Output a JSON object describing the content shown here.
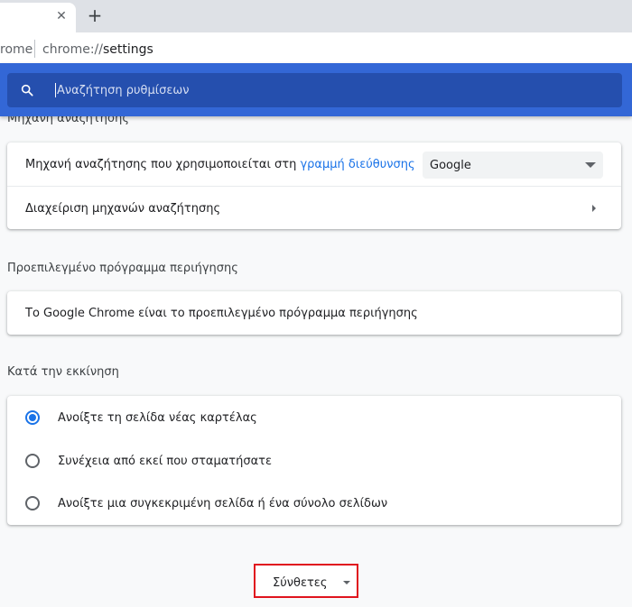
{
  "browser": {
    "tab_close_icon": "close-icon",
    "new_tab_icon": "plus-icon",
    "close_glyph": "✕",
    "plus_glyph": "+",
    "omnibox_prefix": "rome",
    "url_scheme": "chrome://",
    "url_host": "settings"
  },
  "search": {
    "placeholder": "Αναζήτηση ρυθμίσεων",
    "icon": "search-icon"
  },
  "sections": {
    "search_engine": {
      "title": "Μηχανή αναζήτησης",
      "row1_text": "Μηχανή αναζήτησης που χρησιμοποιείται στη ",
      "row1_link": "γραμμή διεύθυνσης",
      "select_value": "Google",
      "row2_text": "Διαχείριση μηχανών αναζήτησης"
    },
    "default_browser": {
      "title": "Προεπιλεγμένο πρόγραμμα περιήγησης",
      "row_text": "Το Google Chrome είναι το προεπιλεγμένο πρόγραμμα περιήγησης"
    },
    "on_startup": {
      "title": "Κατά την εκκίνηση",
      "options": [
        {
          "label": "Ανοίξτε τη σελίδα νέας καρτέλας",
          "checked": true
        },
        {
          "label": "Συνέχεια από εκεί που σταματήσατε",
          "checked": false
        },
        {
          "label": "Ανοίξτε μια συγκεκριμένη σελίδα ή ένα σύνολο σελίδων",
          "checked": false
        }
      ]
    }
  },
  "advanced": {
    "label": "Σύνθετες",
    "highlight_color": "#e0141e"
  },
  "colors": {
    "header_blue": "#3367d6",
    "searchbox_blue": "#254fae",
    "link_blue": "#1a73e8",
    "page_bg": "#f8f9fa"
  }
}
